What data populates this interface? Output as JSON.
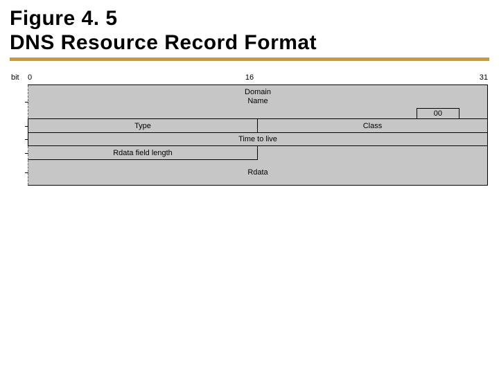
{
  "title": {
    "line1": "Figure 4. 5",
    "line2": "DNS Resource Record Format"
  },
  "bits": {
    "label": "bit",
    "start": "0",
    "mid": "16",
    "end": "31"
  },
  "fields": {
    "domain_name_line1": "Domain",
    "domain_name_line2": "Name",
    "domain_terminator": "00",
    "type": "Type",
    "class": "Class",
    "ttl": "Time to live",
    "rdata_len": "Rdata field length",
    "rdata": "Rdata"
  }
}
